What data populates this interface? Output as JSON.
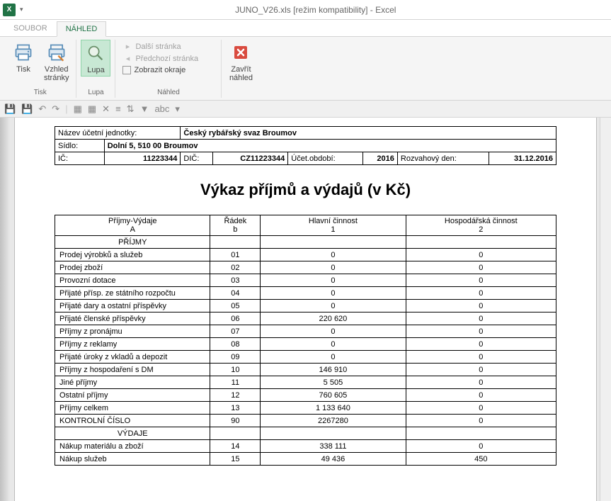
{
  "window": {
    "title": "JUNO_V26.xls  [režim kompatibility] - Excel"
  },
  "tabs": {
    "file": "SOUBOR",
    "preview": "NÁHLED"
  },
  "ribbon": {
    "print": "Tisk",
    "page_layout": "Vzhled\nstránky",
    "group_print": "Tisk",
    "zoom": "Lupa",
    "group_zoom": "Lupa",
    "next_page": "Další stránka",
    "prev_page": "Předchozí stránka",
    "show_margins": "Zobrazit okraje",
    "group_preview": "Náhled",
    "close_preview": "Zavřít\nnáhled"
  },
  "header": {
    "name_label": "Název účetní jednotky:",
    "name_value": "Český rybářský svaz Broumov",
    "seat_label": "Sídlo:",
    "seat_value": "Dolní 5, 510 00 Broumov",
    "ic_label": "IČ:",
    "ic_value": "11223344",
    "dic_label": "DIČ:",
    "dic_value": "CZ11223344",
    "period_label": "Účet.období:",
    "period_value": "2016",
    "balance_day_label": "Rozvahový den:",
    "balance_day_value": "31.12.2016"
  },
  "report_title": "Výkaz příjmů a výdajů (v Kč)",
  "columns": {
    "a_top": "Příjmy-Výdaje",
    "a_sub": "A",
    "b_top": "Řádek",
    "b_sub": "b",
    "c_top": "Hlavní činnost",
    "c_sub": "1",
    "d_top": "Hospodářská činnost",
    "d_sub": "2"
  },
  "sections": {
    "income": "PŘÍJMY",
    "expenses": "VÝDAJE"
  },
  "rows_income": [
    {
      "label": "Prodej výrobků a služeb",
      "row": "01",
      "main": "0",
      "econ": "0"
    },
    {
      "label": "Prodej zboží",
      "row": "02",
      "main": "0",
      "econ": "0"
    },
    {
      "label": "Provozní dotace",
      "row": "03",
      "main": "0",
      "econ": "0"
    },
    {
      "label": "Přijaté přísp. ze státního rozpočtu",
      "row": "04",
      "main": "0",
      "econ": "0"
    },
    {
      "label": "Přijaté dary a ostatní příspěvky",
      "row": "05",
      "main": "0",
      "econ": "0"
    },
    {
      "label": "Přijaté členské příspěvky",
      "row": "06",
      "main": "220 620",
      "econ": "0"
    },
    {
      "label": "Příjmy z pronájmu",
      "row": "07",
      "main": "0",
      "econ": "0"
    },
    {
      "label": "Příjmy z reklamy",
      "row": "08",
      "main": "0",
      "econ": "0"
    },
    {
      "label": "Přijaté úroky z vkladů a depozit",
      "row": "09",
      "main": "0",
      "econ": "0"
    },
    {
      "label": "Příjmy z hospodaření s DM",
      "row": "10",
      "main": "146 910",
      "econ": "0"
    },
    {
      "label": "Jiné příjmy",
      "row": "11",
      "main": "5 505",
      "econ": "0"
    },
    {
      "label": "Ostatní příjmy",
      "row": "12",
      "main": "760 605",
      "econ": "0"
    },
    {
      "label": "Příjmy celkem",
      "row": "13",
      "main": "1 133 640",
      "econ": "0"
    },
    {
      "label": "KONTROLNÍ ČÍSLO",
      "row": "90",
      "main": "2267280",
      "econ": "0"
    }
  ],
  "rows_expenses": [
    {
      "label": "Nákup materiálu a zboží",
      "row": "14",
      "main": "338 111",
      "econ": "0"
    },
    {
      "label": "Nákup služeb",
      "row": "15",
      "main": "49 436",
      "econ": "450"
    }
  ],
  "chart_data": {
    "type": "table",
    "title": "Výkaz příjmů a výdajů (v Kč)",
    "columns": [
      "Příjmy-Výdaje (A)",
      "Řádek (b)",
      "Hlavní činnost (1)",
      "Hospodářská činnost (2)"
    ],
    "rows": [
      [
        "PŘÍJMY",
        "",
        "",
        ""
      ],
      [
        "Prodej výrobků a služeb",
        "01",
        0,
        0
      ],
      [
        "Prodej zboží",
        "02",
        0,
        0
      ],
      [
        "Provozní dotace",
        "03",
        0,
        0
      ],
      [
        "Přijaté přísp. ze státního rozpočtu",
        "04",
        0,
        0
      ],
      [
        "Přijaté dary a ostatní příspěvky",
        "05",
        0,
        0
      ],
      [
        "Přijaté členské příspěvky",
        "06",
        220620,
        0
      ],
      [
        "Příjmy z pronájmu",
        "07",
        0,
        0
      ],
      [
        "Příjmy z reklamy",
        "08",
        0,
        0
      ],
      [
        "Přijaté úroky z vkladů a depozit",
        "09",
        0,
        0
      ],
      [
        "Příjmy z hospodaření s DM",
        "10",
        146910,
        0
      ],
      [
        "Jiné příjmy",
        "11",
        5505,
        0
      ],
      [
        "Ostatní příjmy",
        "12",
        760605,
        0
      ],
      [
        "Příjmy celkem",
        "13",
        1133640,
        0
      ],
      [
        "KONTROLNÍ ČÍSLO",
        "90",
        2267280,
        0
      ],
      [
        "VÝDAJE",
        "",
        "",
        ""
      ],
      [
        "Nákup materiálu a zboží",
        "14",
        338111,
        0
      ],
      [
        "Nákup služeb",
        "15",
        49436,
        450
      ]
    ]
  }
}
